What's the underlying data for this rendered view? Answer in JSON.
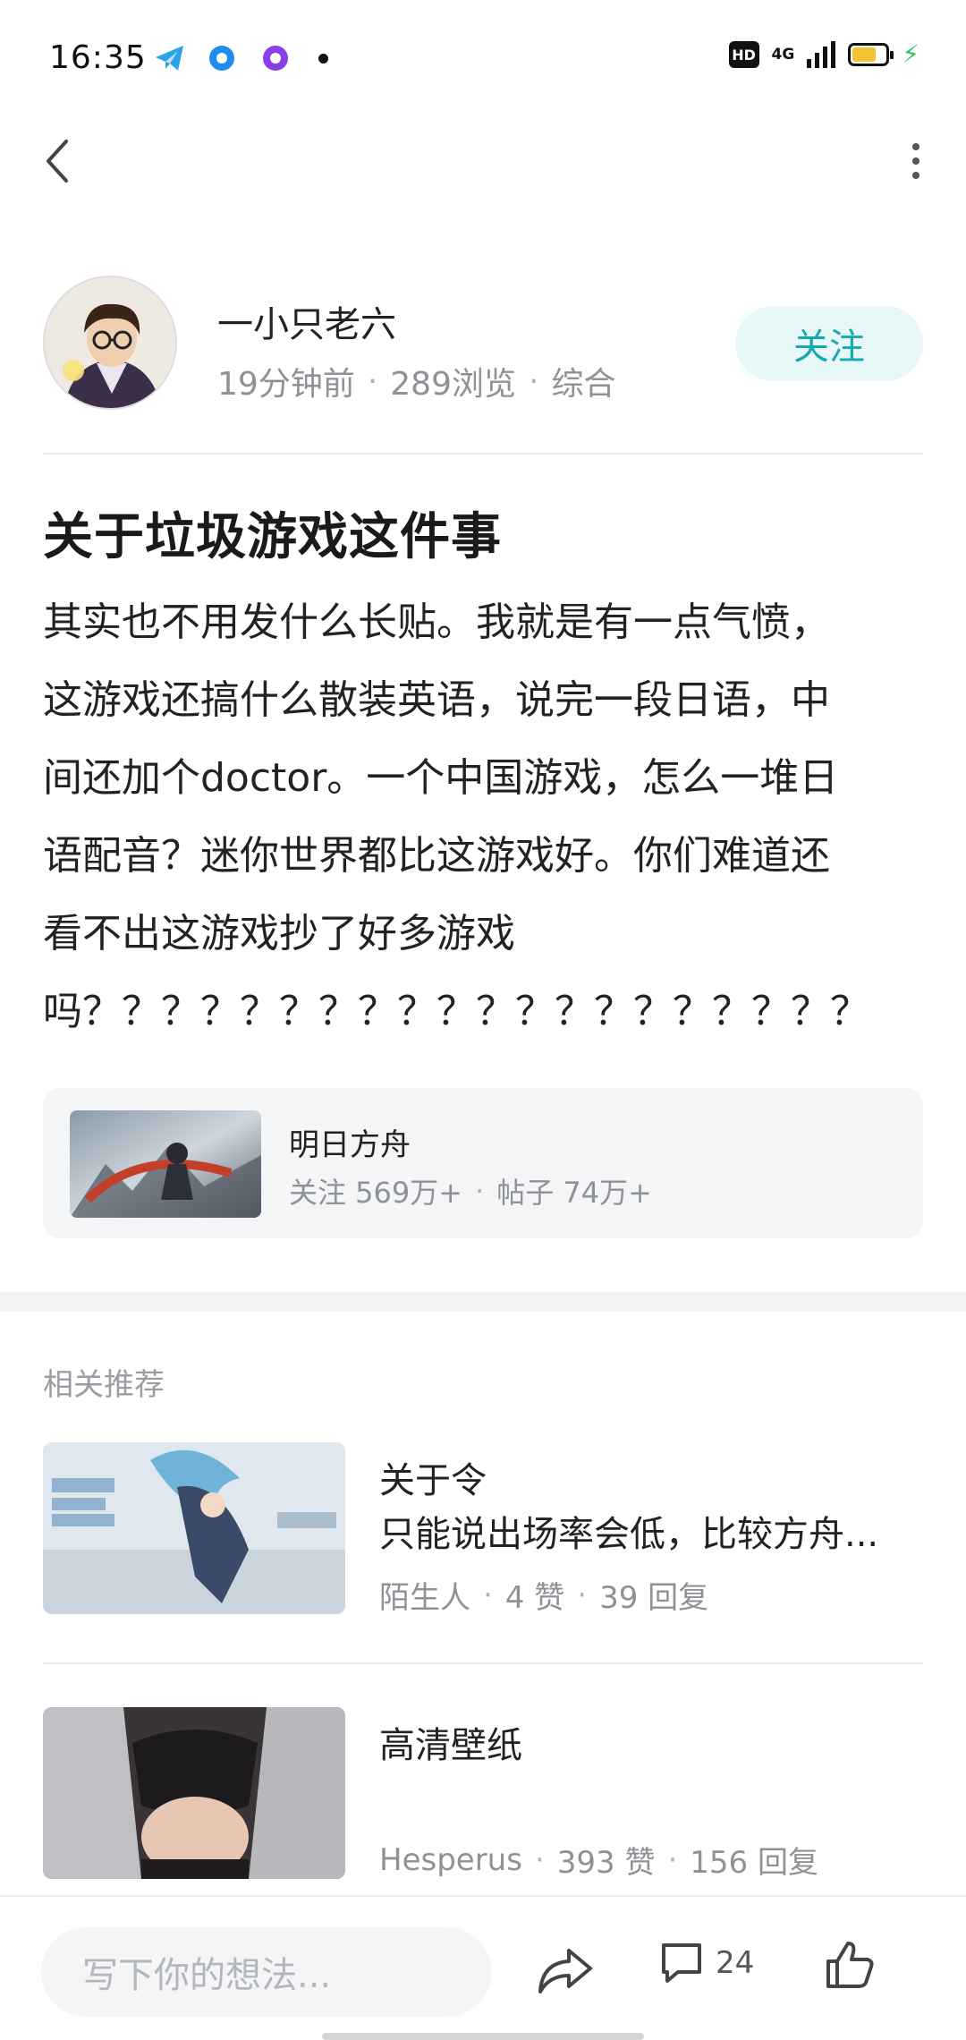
{
  "status_bar": {
    "time": "16:35",
    "hd": "HD",
    "network": "4G"
  },
  "author": {
    "name": "一小只老六",
    "time_ago": "19分钟前",
    "views": "289浏览",
    "category": "综合",
    "follow_label": "关注"
  },
  "post": {
    "title": "关于垃圾游戏这件事",
    "body_lines": [
      "其实也不用发什么长贴。我就是有一点气愤，",
      "这游戏还搞什么散装英语，说完一段日语，中",
      "间还加个doctor。一个中国游戏，怎么一堆日",
      "语配音？迷你世界都比这游戏好。你们难道还",
      "看不出这游戏抄了好多游戏",
      "吗？？？？？？？？？？？？？？？？？？？？"
    ]
  },
  "topic": {
    "name": "明日方舟",
    "followers": "关注 569万+",
    "posts": "帖子 74万+"
  },
  "related": {
    "heading": "相关推荐",
    "items": [
      {
        "title": "关于令",
        "subtitle": "只能说出场率会低，比较方舟...",
        "author": "陌生人",
        "likes": "4 赞",
        "replies": "39 回复"
      },
      {
        "title": "高清壁纸",
        "subtitle": "",
        "author": "Hesperus",
        "likes": "393 赞",
        "replies": "156 回复"
      }
    ]
  },
  "bottom_bar": {
    "input_placeholder": "写下你的想法...",
    "comment_count": "24"
  },
  "colors": {
    "accent": "#15aab0",
    "follow_bg": "#e8f8f8",
    "meta_gray": "#8e9297",
    "card_bg": "#f4f5f7",
    "battery": "#f2c230",
    "charging": "#2ec85a"
  },
  "icons": [
    "back-arrow-icon",
    "more-vertical-icon",
    "share-icon",
    "comment-icon",
    "like-icon",
    "telegram-icon",
    "hd-icon",
    "signal-icon",
    "battery-icon"
  ]
}
